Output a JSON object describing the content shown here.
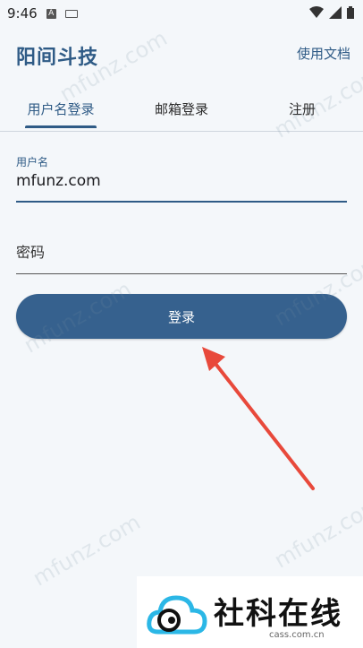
{
  "status": {
    "time": "9:46",
    "a_icon_letter": "A"
  },
  "app": {
    "title": "阳间斗技",
    "docs_label": "使用文档"
  },
  "tabs": [
    {
      "label": "用户名登录"
    },
    {
      "label": "邮箱登录"
    },
    {
      "label": "注册"
    }
  ],
  "form": {
    "username_label": "用户名",
    "username_value": "mfunz.com",
    "password_placeholder": "密码",
    "login_label": "登录"
  },
  "watermark": {
    "text": "mfunz.com"
  },
  "badge": {
    "title": "社科在线",
    "subtitle": "cass.com.cn"
  },
  "colors": {
    "primary": "#36618e",
    "accent_arrow": "#e8493b",
    "background": "#f4f7fa"
  }
}
